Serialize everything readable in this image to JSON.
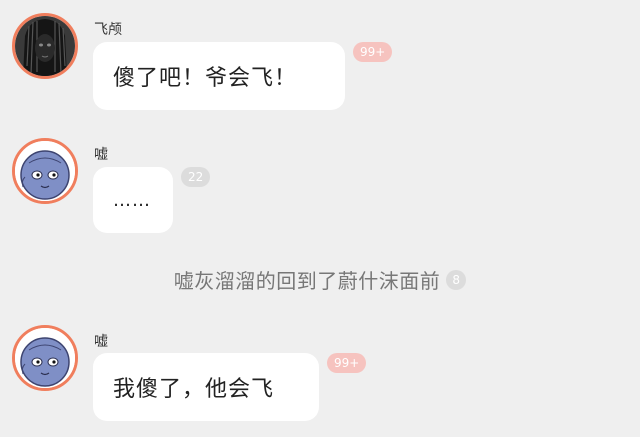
{
  "messages": [
    {
      "sender": "飞颅",
      "text": "傻了吧！爷会飞！",
      "badge": "99+",
      "avatar_icon": "dark-hair-face-avatar"
    },
    {
      "sender": "嘘",
      "text": "……",
      "badge": "22",
      "avatar_icon": "blue-bald-face-avatar"
    },
    {
      "sender": "嘘",
      "text": "我傻了，他会飞",
      "badge": "99+",
      "avatar_icon": "blue-bald-face-avatar"
    }
  ],
  "narration": {
    "text": "嘘灰溜溜的回到了蔚什沫面前",
    "badge": "8"
  },
  "colors": {
    "background": "#efefef",
    "bubble": "#ffffff",
    "avatar_ring": "#f07e5d",
    "hot_badge": "#f6c3bf",
    "gray_badge": "#dcdcdc",
    "narration_text": "#777777"
  }
}
